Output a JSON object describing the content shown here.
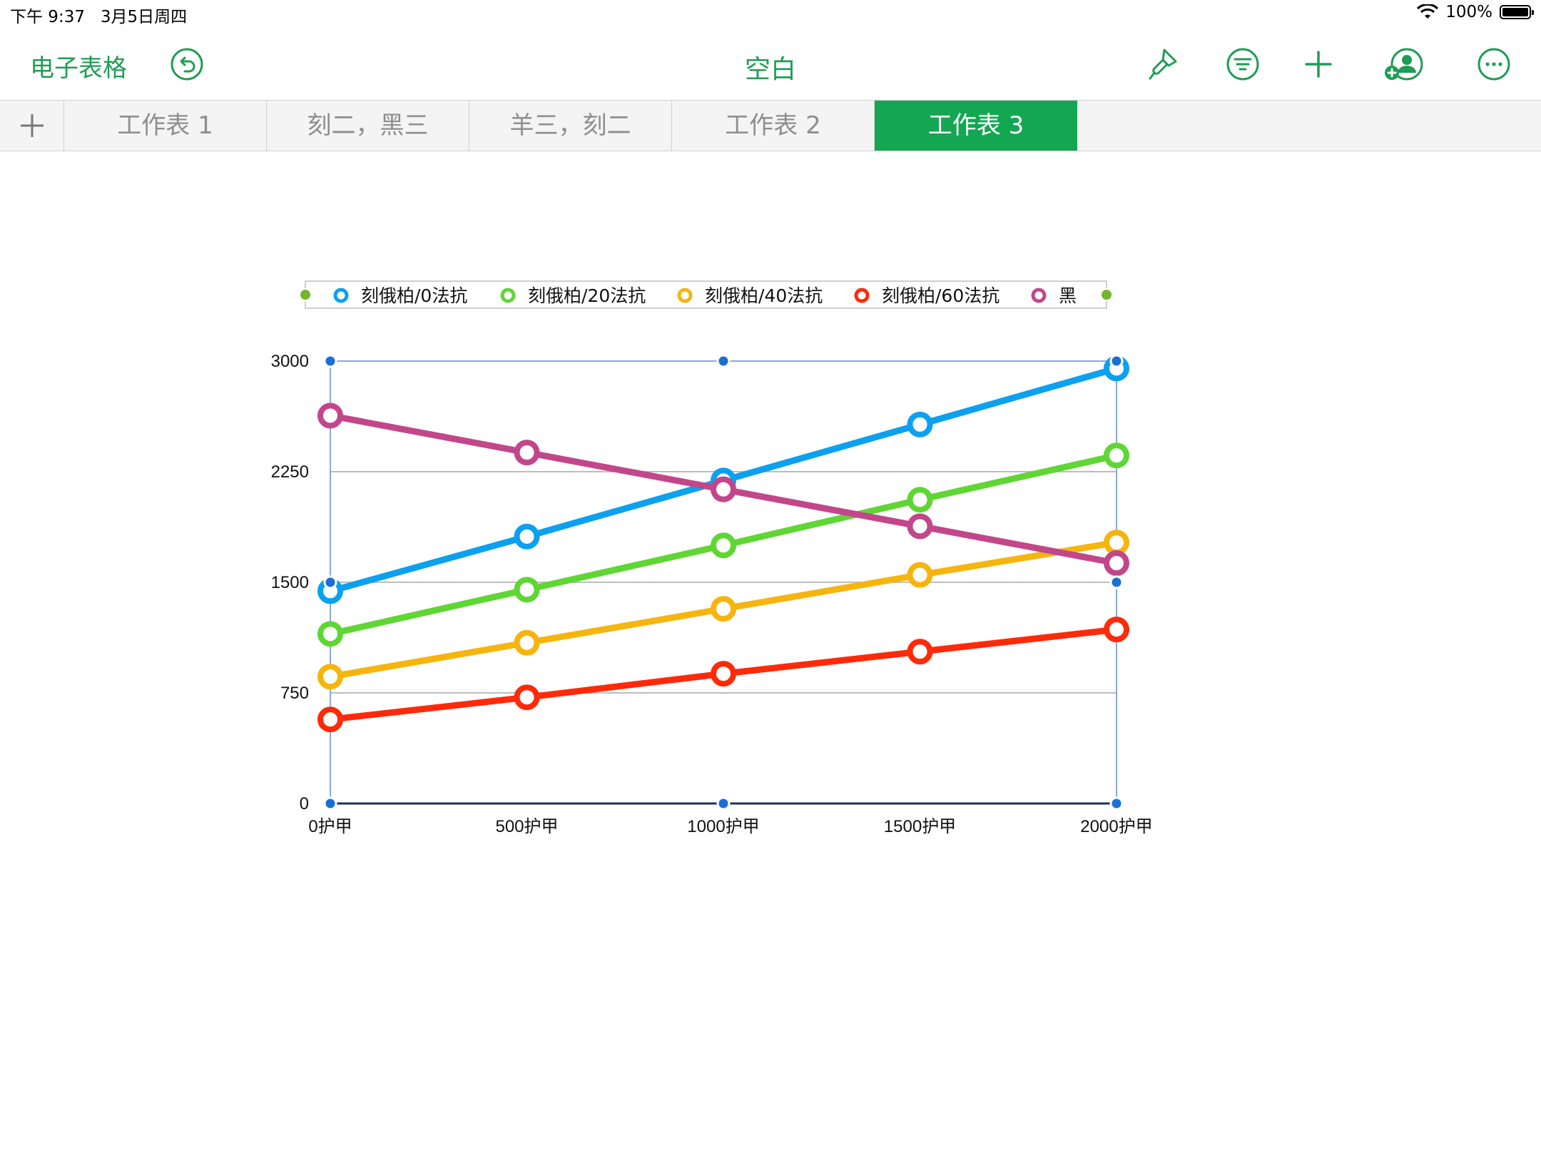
{
  "status": {
    "time": "下午 9:37",
    "date": "3月5日周四",
    "battery": "100%"
  },
  "toolbar": {
    "back_label": "电子表格",
    "title": "空白",
    "icons": [
      "undo-icon",
      "paintbrush-icon",
      "filter-icon",
      "plus-icon",
      "add-collaborator-icon",
      "more-icon"
    ]
  },
  "tabs": [
    {
      "label": "工作表 1",
      "active": false
    },
    {
      "label": "刻二，黑三",
      "active": false
    },
    {
      "label": "羊三，刻二",
      "active": false
    },
    {
      "label": "工作表 2",
      "active": false
    },
    {
      "label": "工作表 3",
      "active": true
    }
  ],
  "colors": {
    "accent": "#1f9d55",
    "tab_active": "#14a752",
    "selection": "#1a6fd6"
  },
  "chart_data": {
    "type": "line",
    "categories": [
      "0护甲",
      "500护甲",
      "1000护甲",
      "1500护甲",
      "2000护甲"
    ],
    "yticks": [
      "0",
      "750",
      "1500",
      "2250",
      "3000"
    ],
    "ylim": [
      0,
      3000
    ],
    "legend_position": "top",
    "grid": true,
    "series": [
      {
        "name": "刻俄柏/0法抗",
        "color": "#0ba1ef",
        "values": [
          1440,
          1810,
          2190,
          2570,
          2950
        ]
      },
      {
        "name": "刻俄柏/20法抗",
        "color": "#5fd634",
        "values": [
          1150,
          1450,
          1750,
          2060,
          2360
        ]
      },
      {
        "name": "刻俄柏/40法抗",
        "color": "#f6b50e",
        "values": [
          860,
          1090,
          1320,
          1550,
          1770
        ]
      },
      {
        "name": "刻俄柏/60法抗",
        "color": "#fe2a09",
        "values": [
          570,
          720,
          880,
          1030,
          1180
        ]
      },
      {
        "name": "黑",
        "color": "#c2478a",
        "values": [
          2630,
          2380,
          2130,
          1880,
          1630
        ]
      }
    ]
  }
}
